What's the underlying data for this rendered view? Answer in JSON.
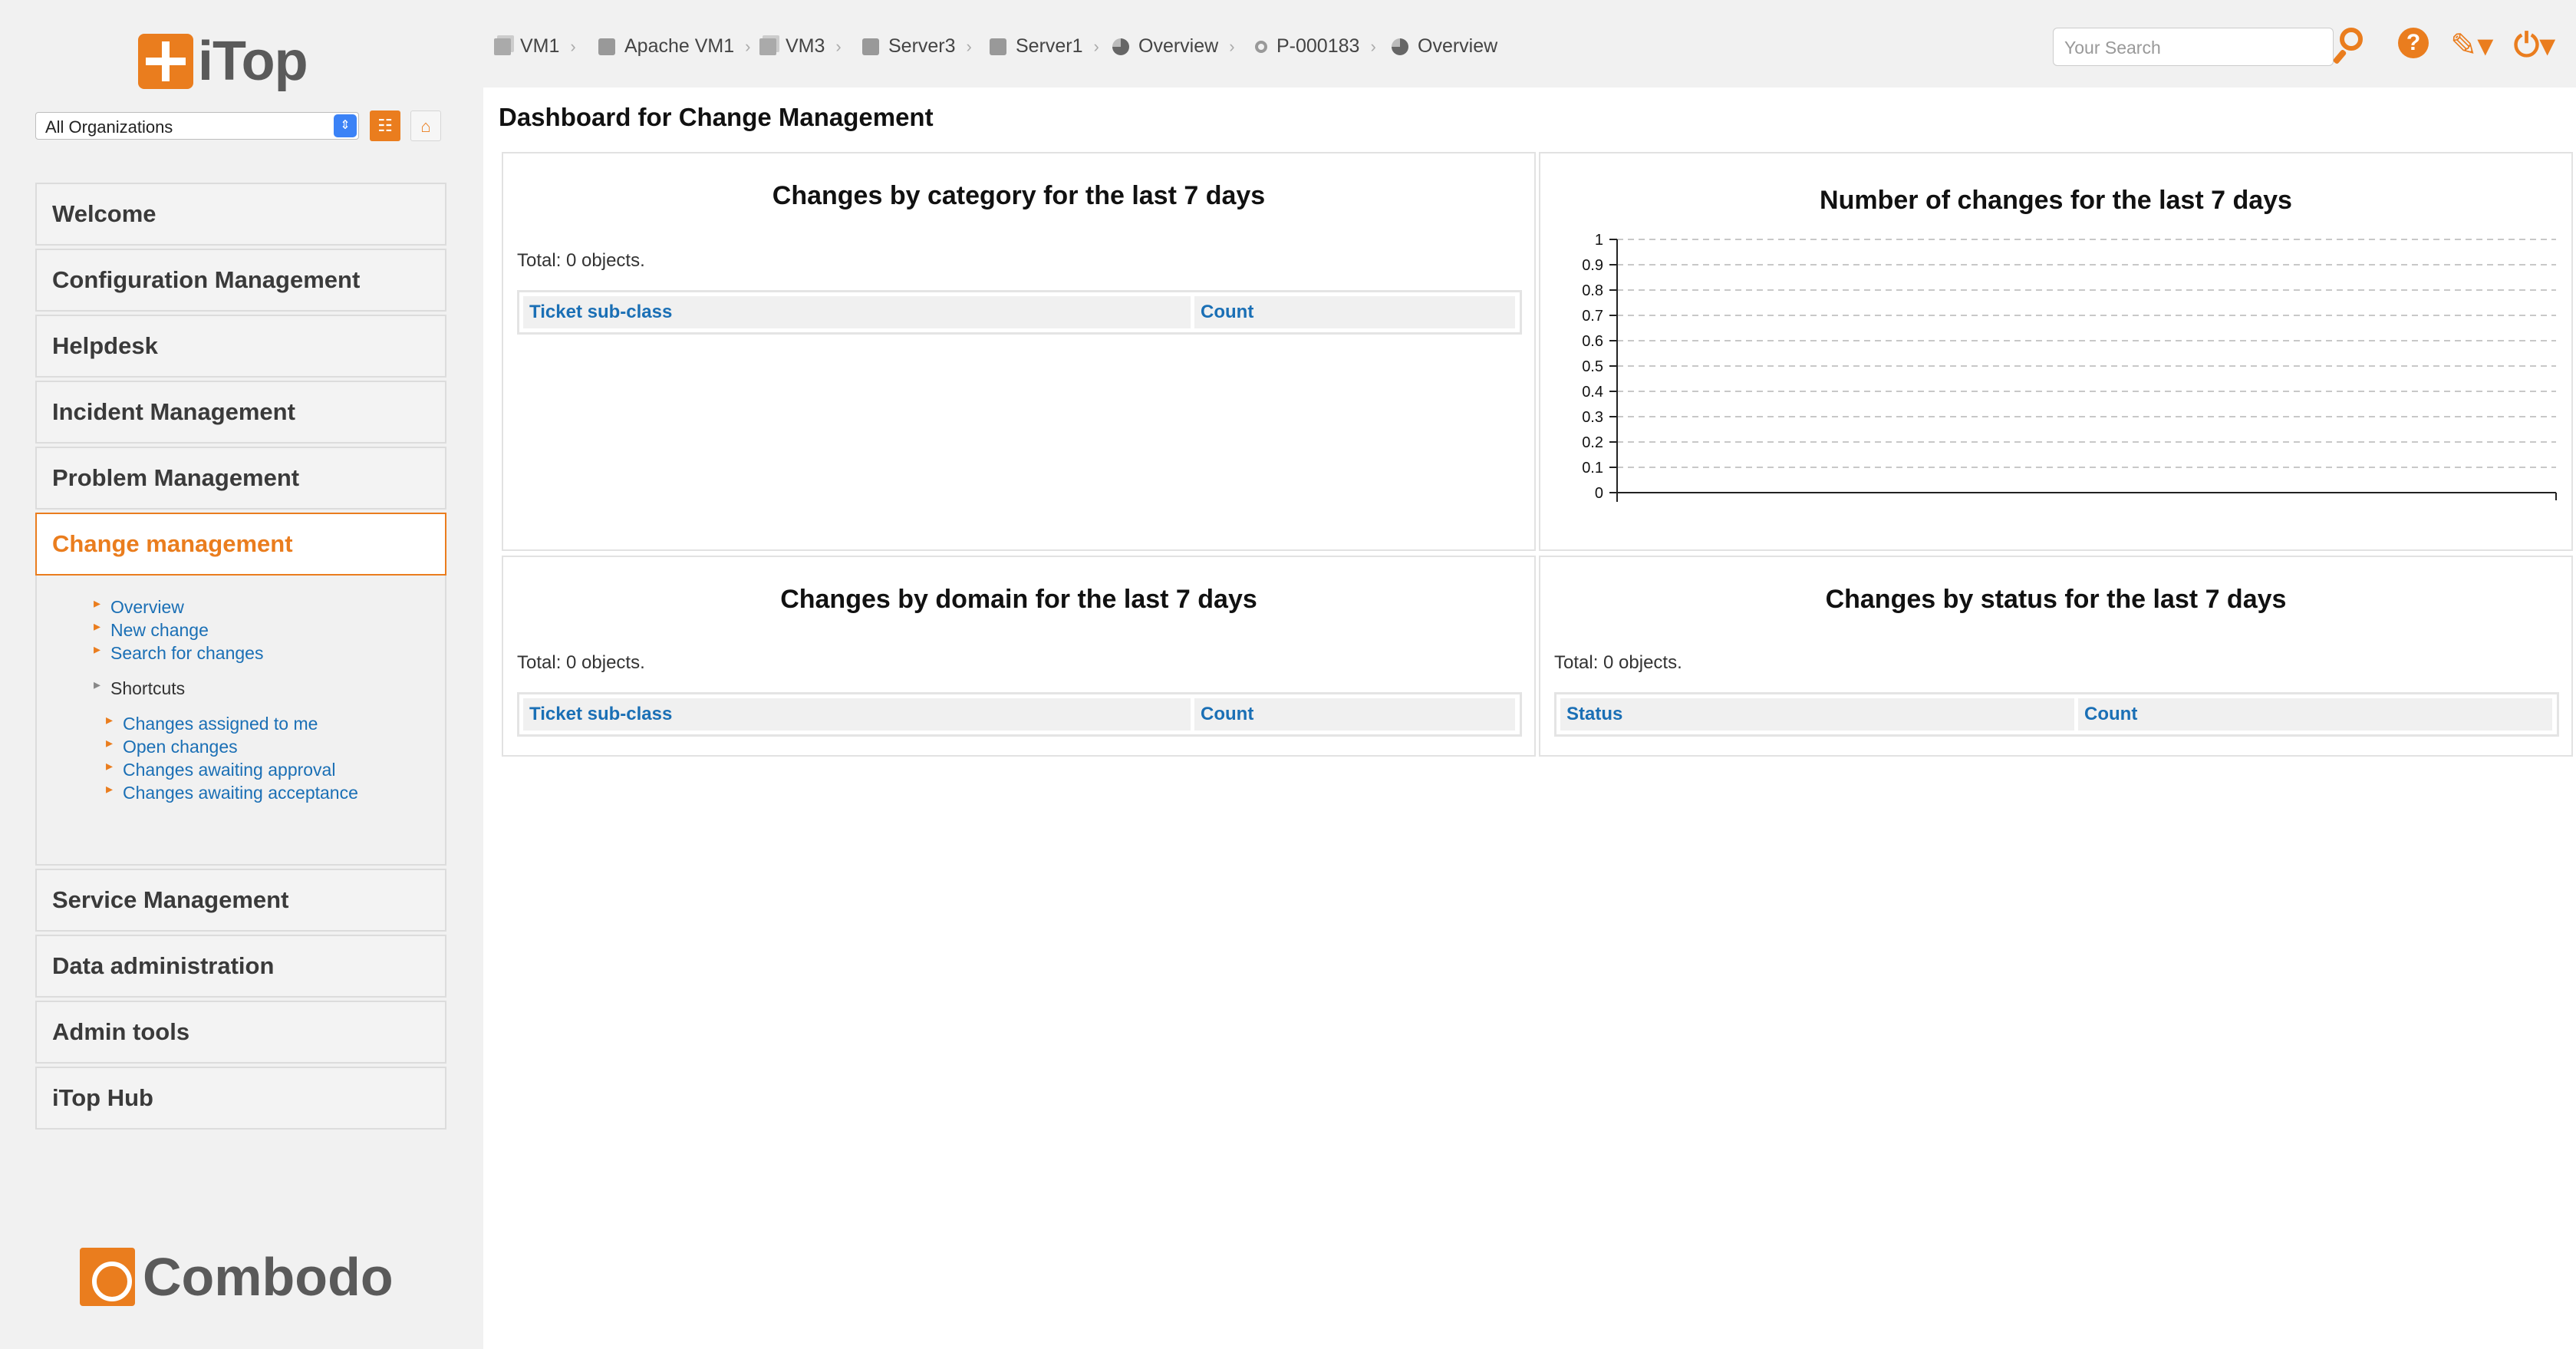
{
  "sidebar": {
    "logo_text": "iTop",
    "org_select_value": "All Organizations",
    "menu": {
      "welcome": "Welcome",
      "configuration": "Configuration Management",
      "helpdesk": "Helpdesk",
      "incident": "Incident Management",
      "problem": "Problem Management",
      "change": "Change management",
      "service": "Service Management",
      "data_admin": "Data administration",
      "admin_tools": "Admin tools",
      "hub": "iTop Hub"
    },
    "change_submenu": {
      "overview": "Overview",
      "new_change": "New change",
      "search_changes": "Search for changes",
      "shortcuts_heading": "Shortcuts",
      "assigned_to_me": "Changes assigned to me",
      "open_changes": "Open changes",
      "awaiting_approval": "Changes awaiting approval",
      "awaiting_acceptance": "Changes awaiting acceptance"
    },
    "footer_logo_text": "Combodo"
  },
  "breadcrumb": {
    "items": [
      {
        "label": "VM1",
        "icon": "virtual-machine-icon"
      },
      {
        "label": "Apache VM1",
        "icon": "web-server-icon"
      },
      {
        "label": "VM3",
        "icon": "virtual-machine-icon"
      },
      {
        "label": "Server3",
        "icon": "server-icon"
      },
      {
        "label": "Server1",
        "icon": "server-icon"
      },
      {
        "label": "Overview",
        "icon": "dashboard-pie-icon"
      },
      {
        "label": "P-000183",
        "icon": "problem-key-icon"
      },
      {
        "label": "Overview",
        "icon": "dashboard-pie-icon"
      }
    ]
  },
  "search": {
    "placeholder": "Your Search"
  },
  "page": {
    "title": "Dashboard for Change Management"
  },
  "panels": {
    "by_category": {
      "title": "Changes by category for the last 7 days",
      "total": "Total: 0 objects.",
      "columns": [
        "Ticket sub-class",
        "Count"
      ]
    },
    "by_domain": {
      "title": "Changes by domain for the last 7 days",
      "total": "Total: 0 objects.",
      "columns": [
        "Ticket sub-class",
        "Count"
      ]
    },
    "by_status": {
      "title": "Changes by status for the last 7 days",
      "total": "Total: 0 objects.",
      "columns": [
        "Status",
        "Count"
      ]
    },
    "count_chart": {
      "title": "Number of changes for the last 7 days"
    }
  },
  "chart_data": {
    "type": "line",
    "title": "Number of changes for the last 7 days",
    "xlabel": "",
    "ylabel": "",
    "ylim": [
      0,
      1
    ],
    "yticks": [
      "0",
      "0.1",
      "0.2",
      "0.3",
      "0.4",
      "0.5",
      "0.6",
      "0.7",
      "0.8",
      "0.9",
      "1"
    ],
    "grid": true,
    "series": []
  },
  "colors": {
    "accent": "#ea7d1e",
    "link": "#1a6fb5",
    "sidebar_bg": "#f1f1f1"
  }
}
